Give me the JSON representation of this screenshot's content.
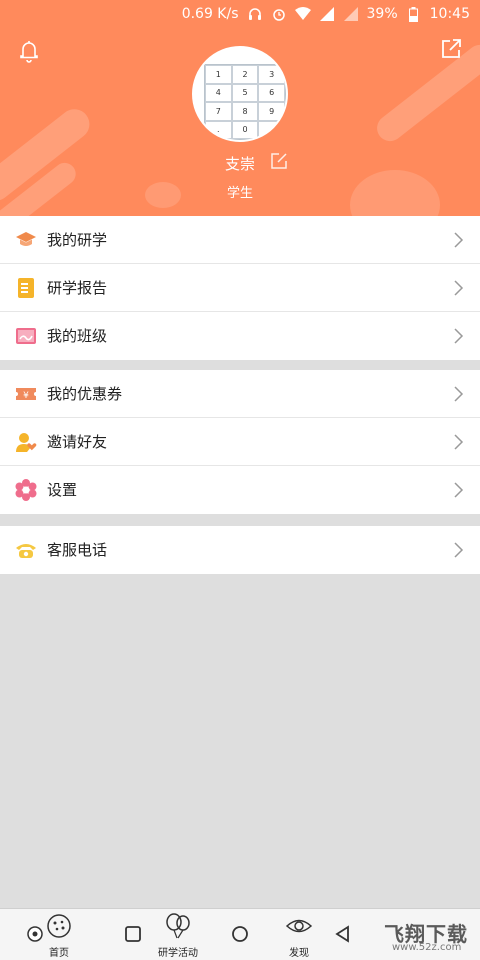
{
  "status_bar": {
    "speed": "0.69 K/s",
    "battery": "39%",
    "time": "10:45"
  },
  "profile": {
    "name": "支崇",
    "role": "学生",
    "avatar_keys": [
      "1",
      "2",
      "3",
      "4",
      "5",
      "6",
      "7",
      "8",
      "9",
      ".",
      "0",
      ""
    ]
  },
  "menu": {
    "group1": [
      {
        "label": "我的研学",
        "icon": "graduation-cap-icon",
        "color": "#f08a4b"
      },
      {
        "label": "研学报告",
        "icon": "report-icon",
        "color": "#f5b42a"
      },
      {
        "label": "我的班级",
        "icon": "class-icon",
        "color": "#ef6d8c"
      }
    ],
    "group2": [
      {
        "label": "我的优惠券",
        "icon": "coupon-icon",
        "color": "#f08a5c"
      },
      {
        "label": "邀请好友",
        "icon": "invite-friend-icon",
        "color": "#f5b42a"
      },
      {
        "label": "设置",
        "icon": "settings-flower-icon",
        "color": "#ef6d8c"
      }
    ],
    "group3": [
      {
        "label": "客服电话",
        "icon": "phone-icon",
        "color": "#f5c842"
      }
    ]
  },
  "bottom_nav": {
    "tabs": [
      {
        "label": "首页",
        "icon": "home-cookie-icon"
      },
      {
        "label": "研学活动",
        "icon": "balloon-icon"
      },
      {
        "label": "发现",
        "icon": "eye-icon"
      }
    ]
  },
  "watermark": {
    "main": "飞翔下载",
    "sub": "www.52z.com"
  },
  "colors": {
    "header": "#ff8a5c",
    "background": "#dedede"
  }
}
